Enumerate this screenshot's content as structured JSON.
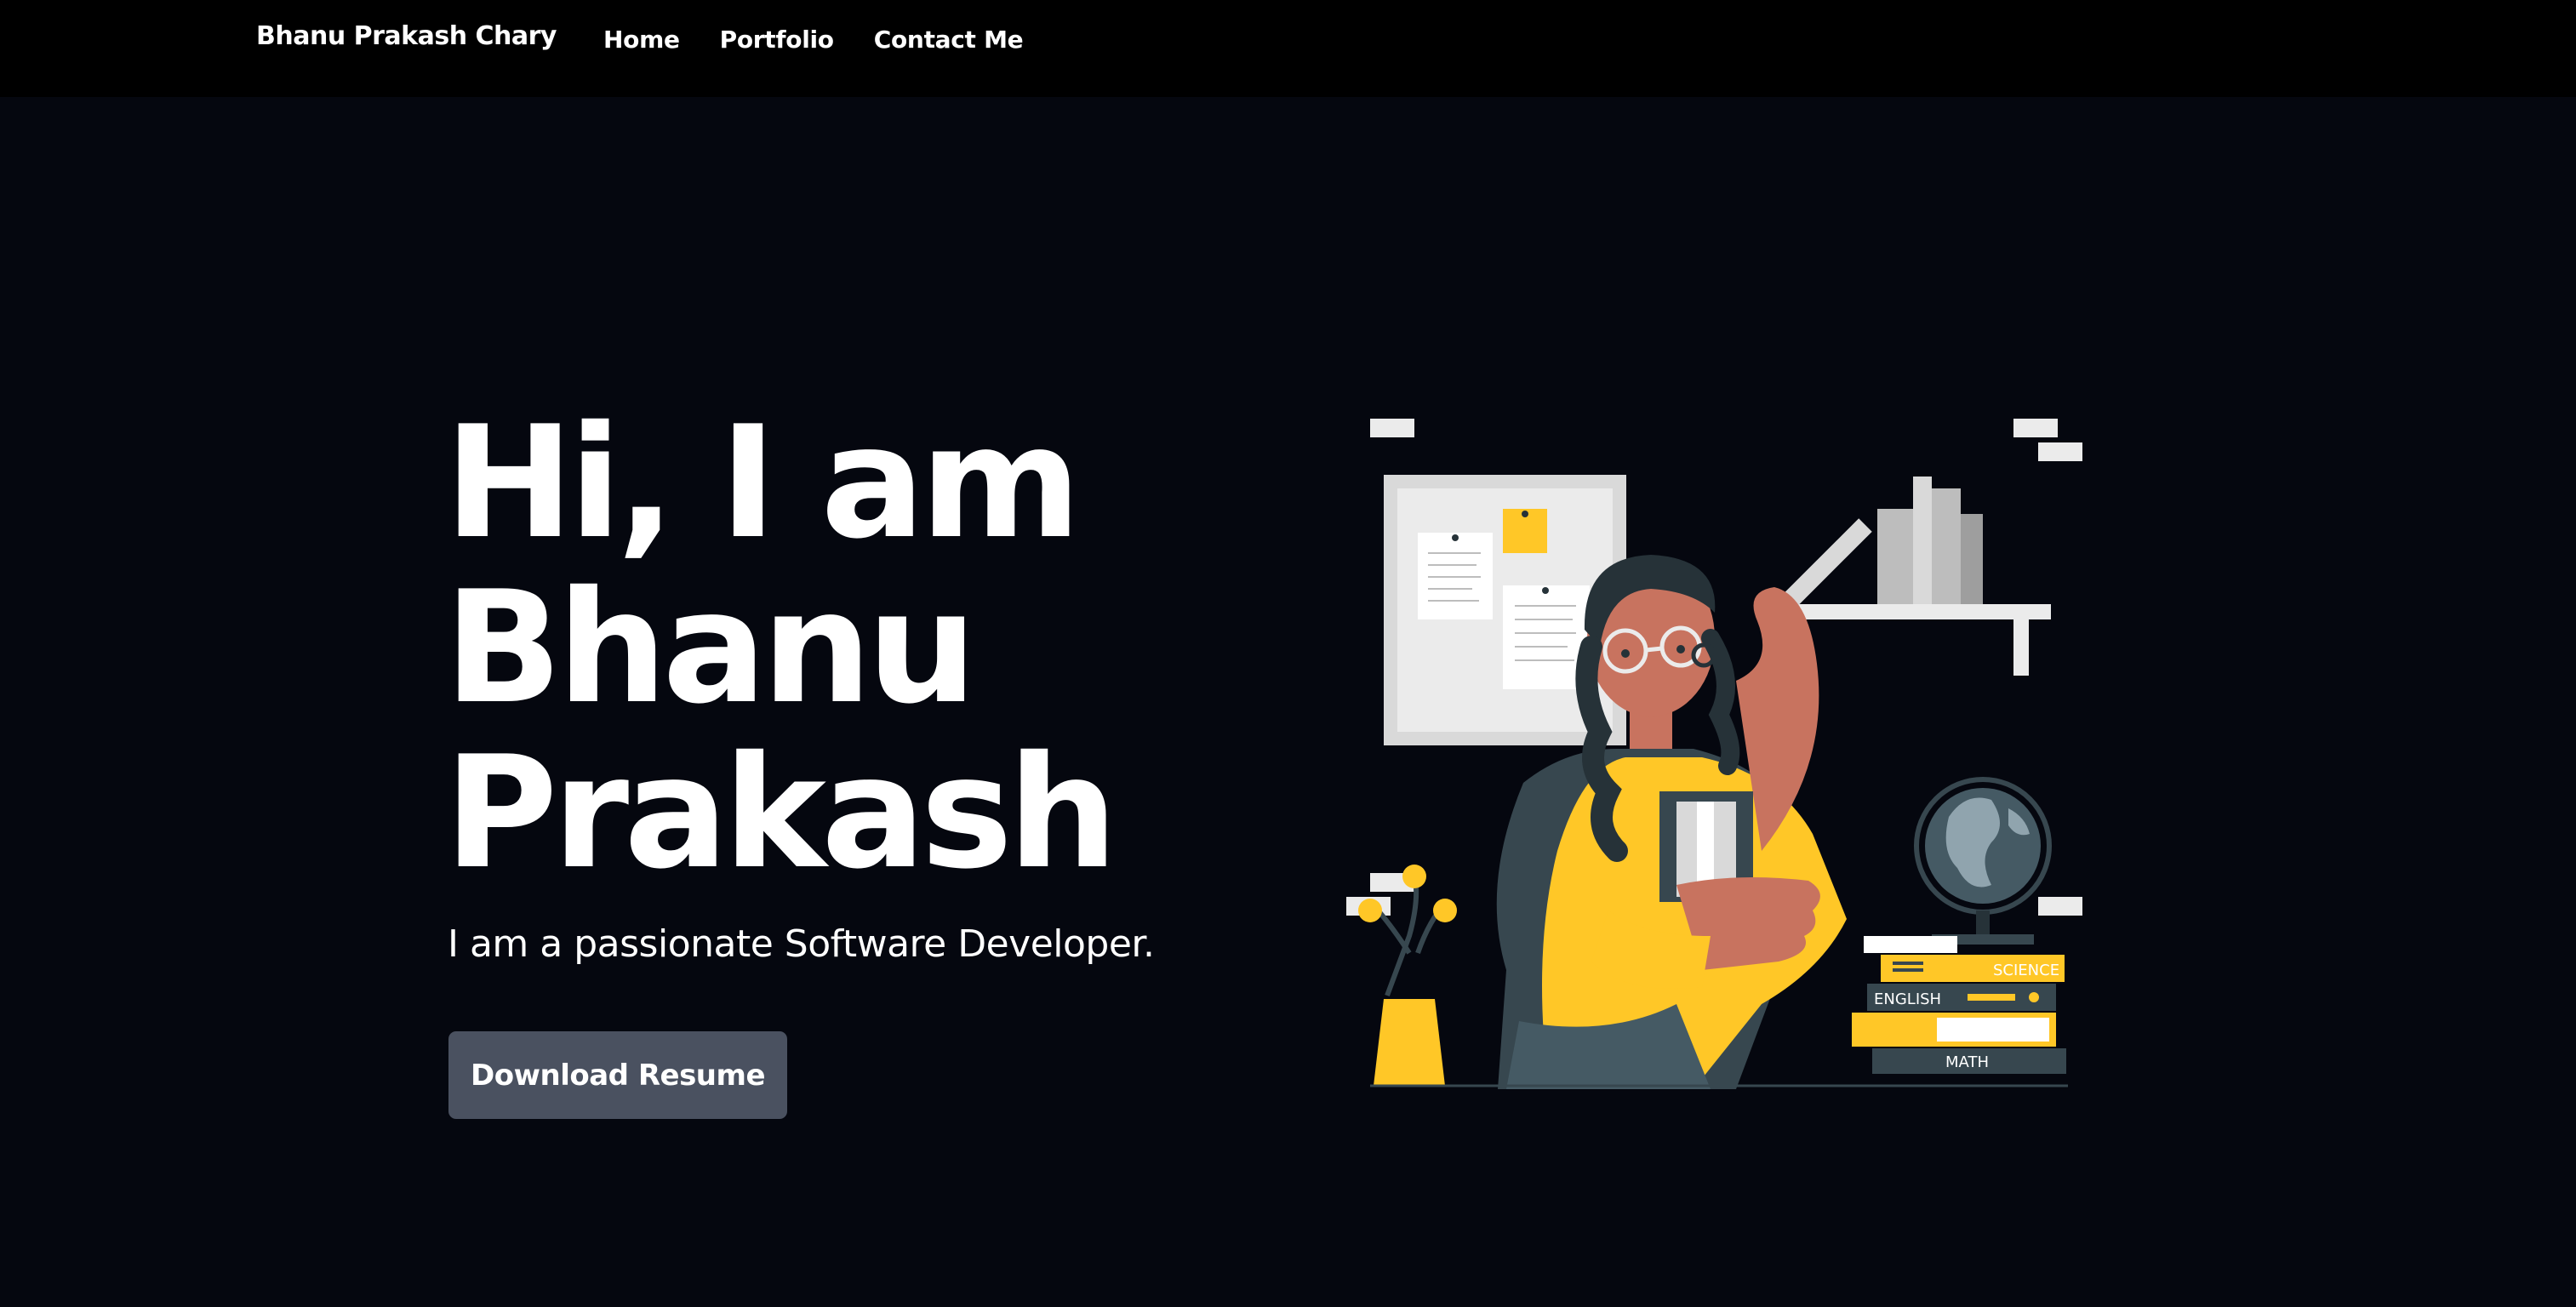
{
  "navbar": {
    "brand": "Bhanu Prakash Chary",
    "links": [
      {
        "label": "Home"
      },
      {
        "label": "Portfolio"
      },
      {
        "label": "Contact Me"
      }
    ]
  },
  "hero": {
    "title_line1": "Hi, I am",
    "title_line2": "Bhanu",
    "title_line3": "Prakash",
    "subtitle": "I am a passionate Software Developer.",
    "cta_label": "Download Resume"
  },
  "illustration": {
    "books": {
      "science": "SCIENCE",
      "english": "ENGLISH",
      "math": "MATH"
    }
  },
  "colors": {
    "background": "#05070f",
    "navbar": "#000000",
    "button": "#4a5160",
    "accent_yellow": "#ffc727",
    "skin": "#c8735f",
    "dark_slate": "#37474f"
  }
}
